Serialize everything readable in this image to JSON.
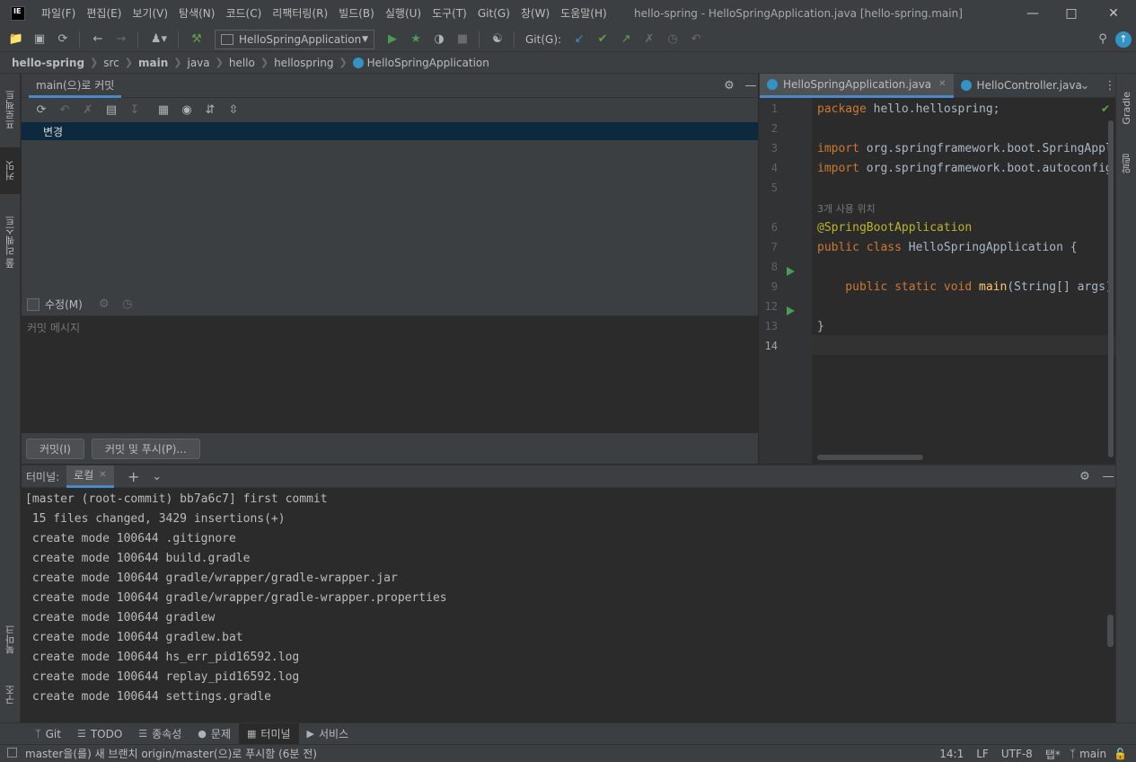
{
  "app": {
    "logo_text": "IE",
    "window_title": "hello-spring - HelloSpringApplication.java [hello-spring.main]"
  },
  "menu": [
    "파일(F)",
    "편집(E)",
    "보기(V)",
    "탐색(N)",
    "코드(C)",
    "리팩터링(R)",
    "빌드(B)",
    "실행(U)",
    "도구(T)",
    "Git(G)",
    "창(W)",
    "도움말(H)"
  ],
  "toolbar": {
    "run_config": "HelloSpringApplication",
    "git_label": "Git(G):"
  },
  "breadcrumb": [
    "hello-spring",
    "src",
    "main",
    "java",
    "hello",
    "hellospring",
    "HelloSpringApplication"
  ],
  "left_strip": {
    "project": "프로젝트",
    "commit": "커밋",
    "pull_requests": "풀 리퀘스트",
    "bookmarks": "북마크",
    "structure": "구조"
  },
  "right_strip": {
    "gradle": "Gradle",
    "notifications": "알림"
  },
  "commit_panel": {
    "tab_label": "main(으)로 커밋",
    "changes_label": "변경",
    "amend_label": "수정(M)",
    "message_placeholder": "커밋 메시지",
    "commit_button": "커밋(I)",
    "commit_push_button": "커밋 및 푸시(P)..."
  },
  "editor": {
    "tabs": [
      {
        "label": "HelloSpringApplication.java"
      },
      {
        "label": "HelloController.java"
      }
    ],
    "line_numbers": [
      "1",
      "2",
      "3",
      "4",
      "5",
      "6",
      "7",
      "8",
      "9",
      "12",
      "13",
      "14"
    ],
    "usage_hint": "3개 사용 위치",
    "code": {
      "l1_kw": "package",
      "l1_rest": " hello.hellospring;",
      "l3_kw": "import",
      "l3_rest": " org.springframework.boot.SpringAppl",
      "l4_kw": "import",
      "l4_rest": " org.springframework.boot.autoconfig",
      "l6_ann": "@SpringBootApplication",
      "l7_kw": "public class",
      "l7_rest": " HelloSpringApplication {",
      "l9_kw": "    public static void",
      "l9_fn": " main",
      "l9_rest": "(String[] args)",
      "l13": "}"
    }
  },
  "terminal": {
    "title": "터미널:",
    "tab_label": "로컬",
    "lines": [
      "[master (root-commit) bb7a6c7] first commit",
      " 15 files changed, 3429 insertions(+)",
      " create mode 100644 .gitignore",
      " create mode 100644 build.gradle",
      " create mode 100644 gradle/wrapper/gradle-wrapper.jar",
      " create mode 100644 gradle/wrapper/gradle-wrapper.properties",
      " create mode 100644 gradlew",
      " create mode 100644 gradlew.bat",
      " create mode 100644 hs_err_pid16592.log",
      " create mode 100644 replay_pid16592.log",
      " create mode 100644 settings.gradle"
    ]
  },
  "bottom_tools": [
    {
      "label": "Git",
      "icon": "branch-icon"
    },
    {
      "label": "TODO",
      "icon": "list-icon"
    },
    {
      "label": "종속성",
      "icon": "layers-icon"
    },
    {
      "label": "문제",
      "icon": "info-icon"
    },
    {
      "label": "터미널",
      "icon": "terminal-icon"
    },
    {
      "label": "서비스",
      "icon": "play-icon"
    }
  ],
  "status": {
    "message": "master을(를) 새 브랜치 origin/master(으)로 푸시함 (6분 전)",
    "position": "14:1",
    "line_sep": "LF",
    "encoding": "UTF-8",
    "indent": "탭*",
    "branch": "main"
  },
  "colors": {
    "accent": "#4a88c7",
    "run_green": "#499c54",
    "keyword": "#cc7832",
    "annotation": "#bbb529"
  }
}
